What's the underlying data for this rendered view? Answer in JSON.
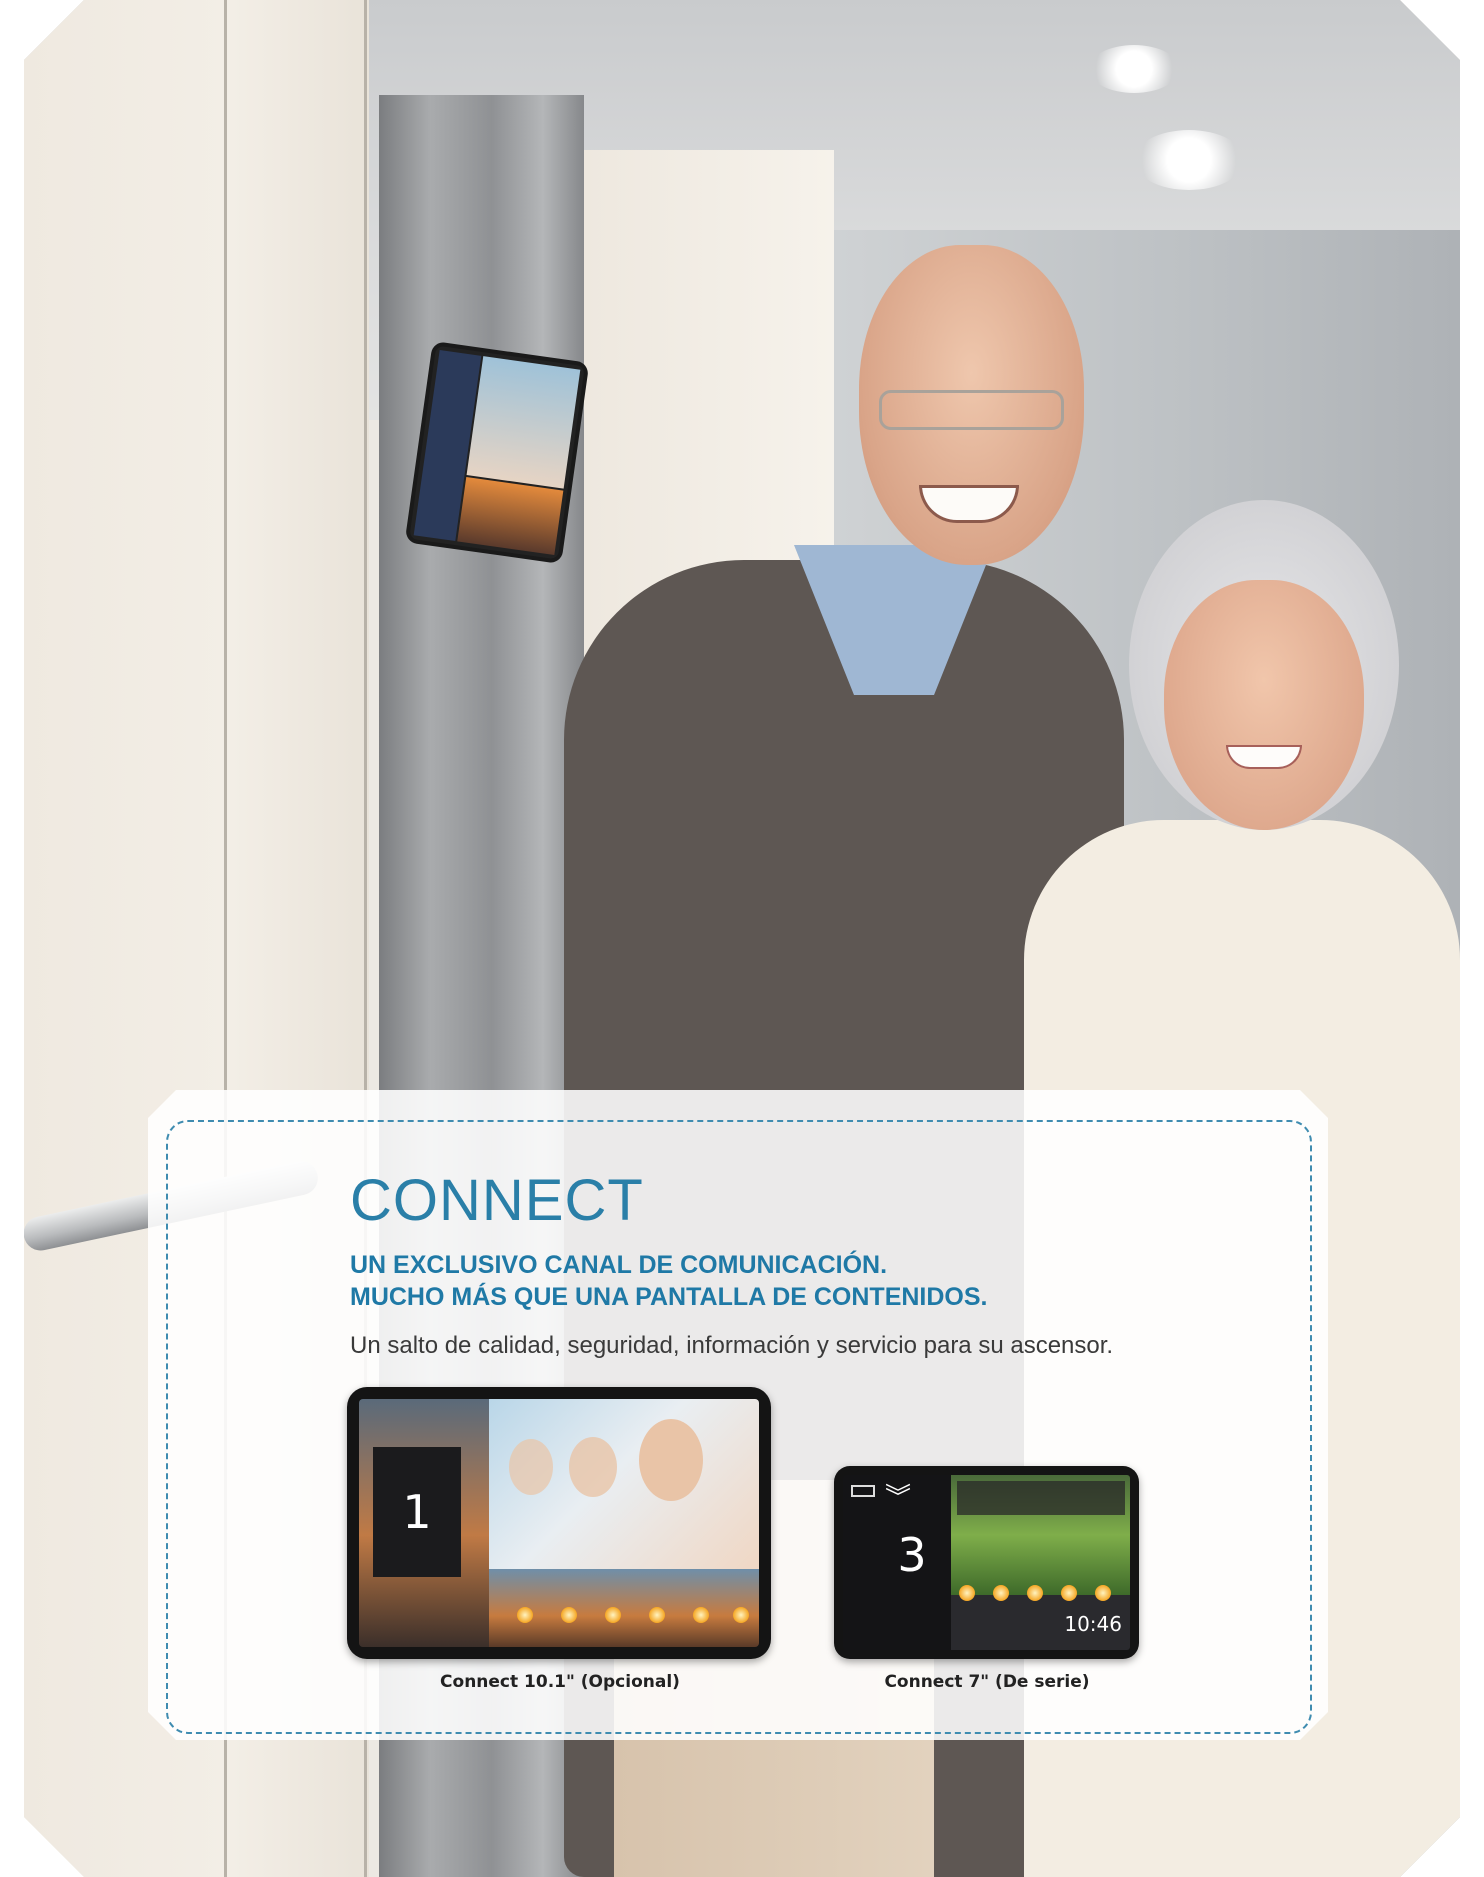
{
  "section": {
    "title": "CONNECT",
    "subtitle_line1": "UN EXCLUSIVO CANAL DE COMUNICACIÓN.",
    "subtitle_line2": "MUCHO MÁS QUE UNA PANTALLA DE CONTENIDOS.",
    "body": "Un salto de calidad, seguridad, información y servicio para su ascensor."
  },
  "devices": [
    {
      "caption": "Connect 10.1\" (Opcional)",
      "floor": "1"
    },
    {
      "caption": "Connect 7\" (De serie)",
      "floor": "3",
      "time": "10:46"
    }
  ],
  "colors": {
    "accent_blue": "#2a7fa8",
    "dashed_border": "#3f8cb0",
    "body_text": "#3a3a3a"
  }
}
